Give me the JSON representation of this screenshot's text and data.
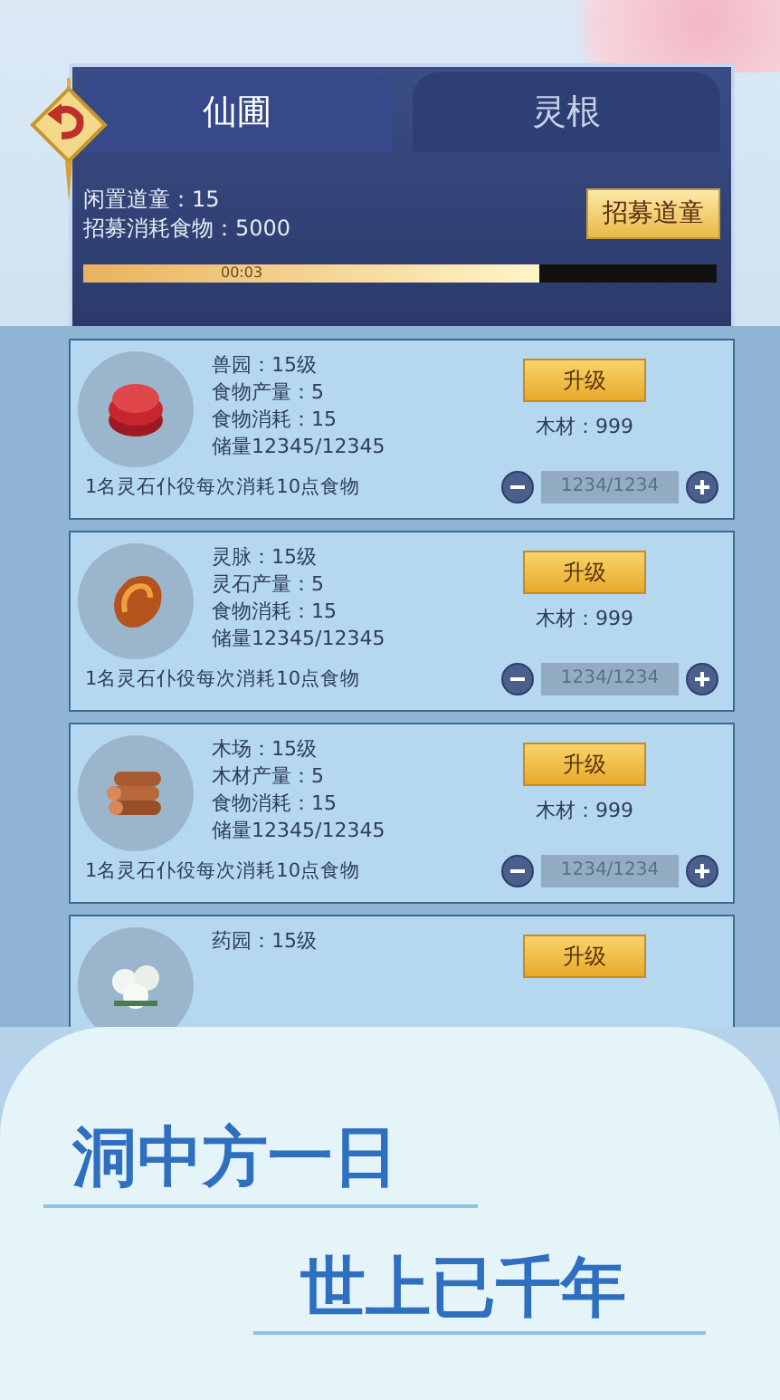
{
  "tabs": [
    {
      "label": "仙圃",
      "selected": true
    },
    {
      "label": "灵根",
      "selected": false
    }
  ],
  "summary": {
    "idle": "闲置道童：15",
    "cost": "招募消耗食物：5000",
    "recruit_button": "招募道童"
  },
  "timer": {
    "label": "00:03",
    "level": 0.72
  },
  "buildings": [
    {
      "kind": "meat",
      "title": "兽园：15级",
      "output": "食物产量：5",
      "consume": "食物消耗：15",
      "storage": "储量12345/12345",
      "upgrade": "升级",
      "wood": "木材：999",
      "note": "1名灵石仆役每次消耗10点食物",
      "amount": "1234/1234"
    },
    {
      "kind": "stone",
      "title": "灵脉：15级",
      "output": "灵石产量：5",
      "consume": "食物消耗：15",
      "storage": "储量12345/12345",
      "upgrade": "升级",
      "wood": "木材：999",
      "note": "1名灵石仆役每次消耗10点食物",
      "amount": "1234/1234"
    },
    {
      "kind": "wood",
      "title": "木场：15级",
      "output": "木材产量：5",
      "consume": "食物消耗：15",
      "storage": "储量12345/12345",
      "upgrade": "升级",
      "wood": "木材：999",
      "note": "1名灵石仆役每次消耗10点食物",
      "amount": "1234/1234"
    },
    {
      "kind": "herb",
      "title": "药园：15级",
      "upgrade": "升级"
    }
  ],
  "slogans": [
    "洞中方一日",
    "世上已千年"
  ]
}
